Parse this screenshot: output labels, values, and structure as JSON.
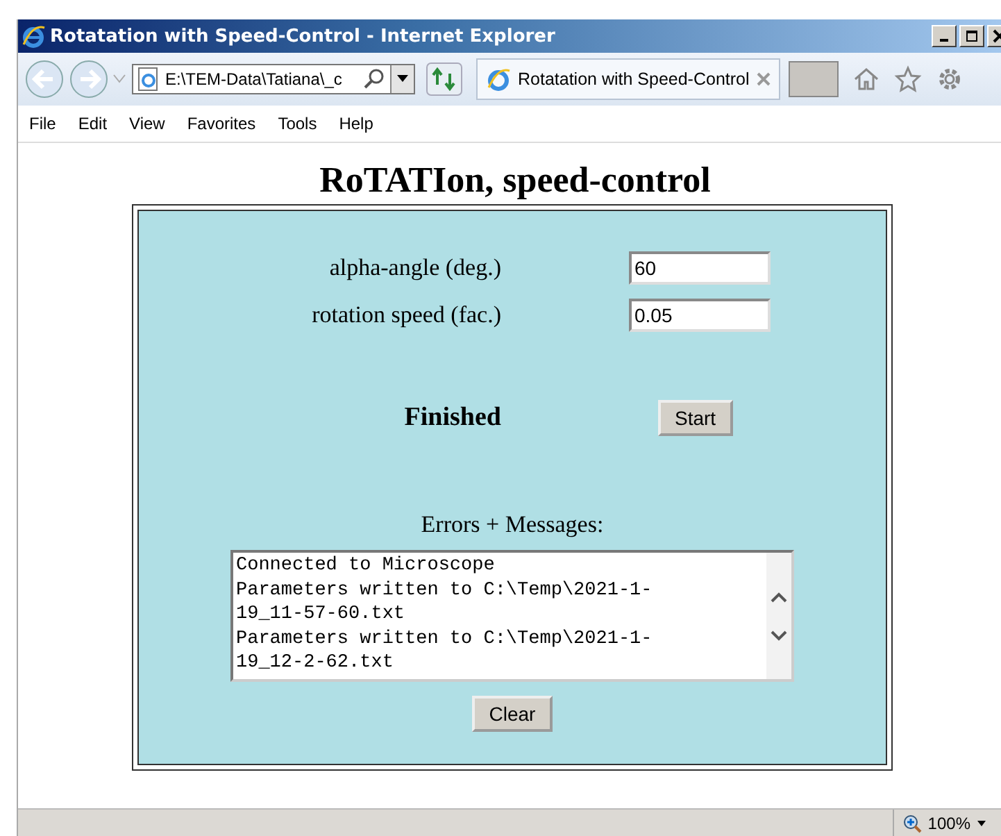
{
  "window": {
    "title": "Rotatation with Speed-Control - Internet Explorer"
  },
  "address_bar": {
    "value": "E:\\TEM-Data\\Tatiana\\_c"
  },
  "tabs": [
    {
      "label": "Rotatation with Speed-Control",
      "selected": true
    }
  ],
  "menu": [
    "File",
    "Edit",
    "View",
    "Favorites",
    "Tools",
    "Help"
  ],
  "page": {
    "heading": "RoTATIon, speed-control",
    "fields": [
      {
        "label": "alpha-angle (deg.)",
        "value": "60"
      },
      {
        "label": "rotation speed (fac.)",
        "value": "0.05"
      }
    ],
    "status": "Finished",
    "start_button": "Start",
    "messages_label": "Errors + Messages:",
    "messages": [
      "Connected to Microscope",
      "Parameters written to C:\\Temp\\2021-1-",
      "19_11-57-60.txt",
      "Parameters written to C:\\Temp\\2021-1-",
      "19_12-2-62.txt"
    ],
    "clear_button": "Clear"
  },
  "status_bar": {
    "zoom": "100%"
  }
}
